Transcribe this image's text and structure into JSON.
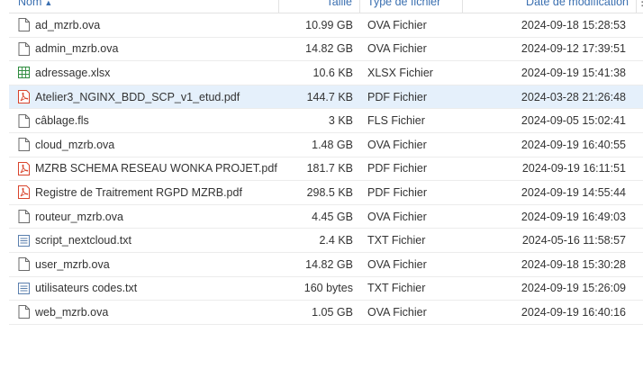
{
  "header": {
    "name": "Nom",
    "sort_indicator": "▲",
    "size": "Taille",
    "type": "Type de fichier",
    "date": "Date de modification",
    "more": "⋮"
  },
  "files": [
    {
      "name": "ad_mzrb.ova",
      "size": "10.99 GB",
      "type": "OVA Fichier",
      "date": "2024-09-18 15:28:53",
      "icon": "file-icon"
    },
    {
      "name": "admin_mzrb.ova",
      "size": "14.82 GB",
      "type": "OVA Fichier",
      "date": "2024-09-12 17:39:51",
      "icon": "file-icon"
    },
    {
      "name": "adressage.xlsx",
      "size": "10.6 KB",
      "type": "XLSX Fichier",
      "date": "2024-09-19 15:41:38",
      "icon": "spreadsheet-icon"
    },
    {
      "name": "Atelier3_NGINX_BDD_SCP_v1_etud.pdf",
      "size": "144.7 KB",
      "type": "PDF Fichier",
      "date": "2024-03-28 21:26:48",
      "icon": "pdf-icon",
      "selected": true
    },
    {
      "name": "câblage.fls",
      "size": "3 KB",
      "type": "FLS Fichier",
      "date": "2024-09-05 15:02:41",
      "icon": "file-icon"
    },
    {
      "name": "cloud_mzrb.ova",
      "size": "1.48 GB",
      "type": "OVA Fichier",
      "date": "2024-09-19 16:40:55",
      "icon": "file-icon"
    },
    {
      "name": "MZRB SCHEMA RESEAU WONKA PROJET.pdf",
      "size": "181.7 KB",
      "type": "PDF Fichier",
      "date": "2024-09-19 16:11:51",
      "icon": "pdf-icon"
    },
    {
      "name": "Registre de Traitrement RGPD MZRB.pdf",
      "size": "298.5 KB",
      "type": "PDF Fichier",
      "date": "2024-09-19 14:55:44",
      "icon": "pdf-icon"
    },
    {
      "name": "routeur_mzrb.ova",
      "size": "4.45 GB",
      "type": "OVA Fichier",
      "date": "2024-09-19 16:49:03",
      "icon": "file-icon"
    },
    {
      "name": "script_nextcloud.txt",
      "size": "2.4 KB",
      "type": "TXT Fichier",
      "date": "2024-05-16 11:58:57",
      "icon": "text-file-icon"
    },
    {
      "name": "user_mzrb.ova",
      "size": "14.82 GB",
      "type": "OVA Fichier",
      "date": "2024-09-18 15:30:28",
      "icon": "file-icon"
    },
    {
      "name": "utilisateurs codes.txt",
      "size": "160 bytes",
      "type": "TXT Fichier",
      "date": "2024-09-19 15:26:09",
      "icon": "text-file-icon"
    },
    {
      "name": "web_mzrb.ova",
      "size": "1.05 GB",
      "type": "OVA Fichier",
      "date": "2024-09-19 16:40:16",
      "icon": "file-icon"
    }
  ],
  "colors": {
    "header_text": "#3a6fb0",
    "selected_row": "#e5f0fb",
    "pdf_red": "#d9442c",
    "xlsx_green": "#2e8b3e",
    "text_lines": "#5a7fae"
  }
}
